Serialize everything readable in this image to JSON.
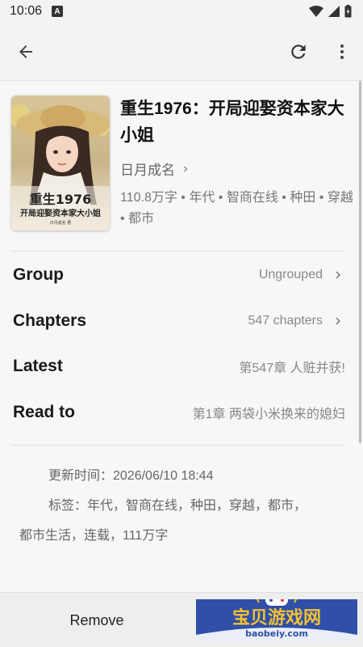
{
  "status_bar": {
    "time": "10:06",
    "notification_icon": "A"
  },
  "app_bar": {
    "back_icon": "arrow-back-icon",
    "refresh_icon": "refresh-icon",
    "more_icon": "more-vert-icon"
  },
  "book": {
    "title": "重生1976：开局迎娶资本家大小姐",
    "author": "日月成名",
    "meta": "110.8万字 • 年代 • 智商在线 • 种田 • 穿越 • 都市",
    "cover_title_line1": "重生1976",
    "cover_title_line2": "开局迎娶资本家大小姐",
    "cover_author": "日月成名 著"
  },
  "info": {
    "group_label": "Group",
    "group_value": "Ungrouped",
    "chapters_label": "Chapters",
    "chapters_value": "547 chapters",
    "latest_label": "Latest",
    "latest_value": "第547章 人赃并获!",
    "readto_label": "Read to",
    "readto_value": "第1章 两袋小米换来的媳妇"
  },
  "description": {
    "update_time": "更新时间：2026/06/10 18:44",
    "tags_line1": "标签：年代，智商在线，种田，穿越，都市，",
    "tags_line2": "都市生活，连载，111万字"
  },
  "bottom": {
    "remove_label": "Remove",
    "watermark_text": "宝贝游戏网",
    "watermark_url": "baobeiy.com"
  },
  "colors": {
    "background": "#f7f7f7",
    "accent_watermark": "#2f4fa8"
  }
}
